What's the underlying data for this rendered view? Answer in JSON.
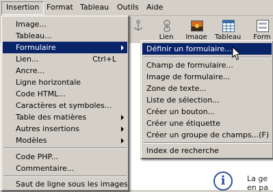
{
  "menubar": {
    "items": [
      {
        "label": "Insertion"
      },
      {
        "label": "Format"
      },
      {
        "label": "Tableau"
      },
      {
        "label": "Outils"
      },
      {
        "label": "Aide"
      }
    ]
  },
  "toolbar": {
    "buttons": [
      {
        "label": "",
        "icon": "anchor-icon"
      },
      {
        "label": "Lien",
        "icon": "link-icon"
      },
      {
        "label": "Image",
        "icon": "image-icon"
      },
      {
        "label": "Tableau",
        "icon": "table-icon"
      },
      {
        "label": "Form",
        "icon": "form-icon"
      }
    ]
  },
  "insertion_menu": {
    "items": [
      {
        "label": "Image..."
      },
      {
        "label": "Tableau..."
      },
      {
        "label": "Formulaire",
        "submenu": true,
        "highlighted": true
      },
      {
        "label": "Lien...",
        "shortcut": "Ctrl+L"
      },
      {
        "label": "Ancre..."
      },
      {
        "label": "Ligne horizontale"
      },
      {
        "label": "Code HTML..."
      },
      {
        "label": "Caractères et symboles..."
      },
      {
        "label": "Table des matières",
        "submenu": true
      },
      {
        "label": "Autres insertions",
        "submenu": true
      },
      {
        "label": "Modèles",
        "submenu": true
      },
      {
        "label": "Code PHP..."
      },
      {
        "label": "Commentaire..."
      },
      {
        "label": "Saut de ligne sous les images"
      }
    ]
  },
  "formulaire_submenu": {
    "items": [
      {
        "label": "Définir un formulaire...",
        "highlighted": true
      },
      {
        "label": "Champ de formulaire..."
      },
      {
        "label": "Image de formulaire..."
      },
      {
        "label": "Zone de texte..."
      },
      {
        "label": "Liste de sélection..."
      },
      {
        "label": "Créer un bouton..."
      },
      {
        "label": "Créer une étiquette"
      },
      {
        "label": "Créer un groupe de champs...(F)"
      },
      {
        "label": "Index de recherche"
      }
    ]
  },
  "document": {
    "text_line1": "La ge",
    "text_line2": "en pa"
  },
  "colors": {
    "highlight": "#0a246a",
    "menu_bg": "#d4d0c8"
  }
}
